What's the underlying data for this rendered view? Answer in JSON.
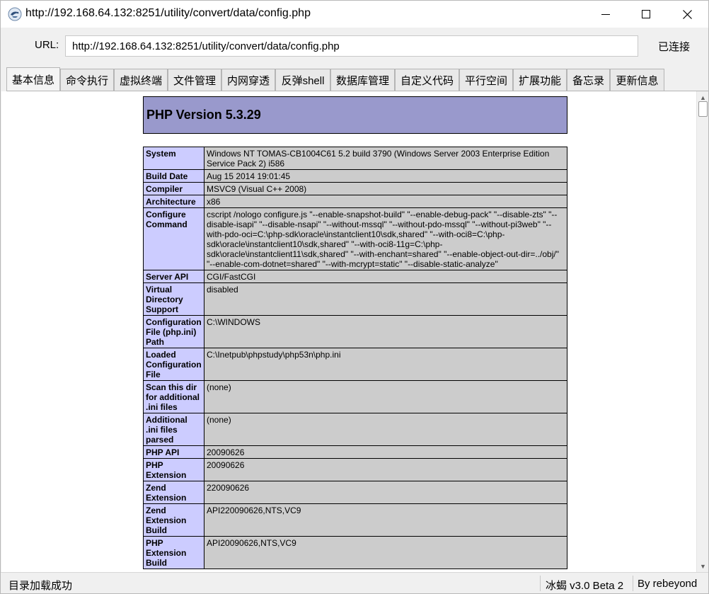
{
  "window": {
    "title": "http://192.168.64.132:8251/utility/convert/data/config.php",
    "icon": "scorpion-app-icon"
  },
  "urlbar": {
    "label": "URL:",
    "value": "http://192.168.64.132:8251/utility/convert/data/config.php",
    "status": "已连接"
  },
  "tabs": [
    {
      "label": "基本信息",
      "active": true
    },
    {
      "label": "命令执行"
    },
    {
      "label": "虚拟终端"
    },
    {
      "label": "文件管理"
    },
    {
      "label": "内网穿透"
    },
    {
      "label": "反弹shell"
    },
    {
      "label": "数据库管理"
    },
    {
      "label": "自定义代码"
    },
    {
      "label": "平行空间"
    },
    {
      "label": "扩展功能"
    },
    {
      "label": "备忘录"
    },
    {
      "label": "更新信息"
    }
  ],
  "phpinfo": {
    "heading": "PHP Version 5.3.29",
    "header_color": "#9999cc",
    "key_color": "#ccccff",
    "value_color": "#cccccc",
    "rows": [
      {
        "key": "System",
        "value": "Windows NT TOMAS-CB1004C61 5.2 build 3790 (Windows Server 2003 Enterprise Edition Service Pack 2) i586"
      },
      {
        "key": "Build Date",
        "value": "Aug 15 2014 19:01:45"
      },
      {
        "key": "Compiler",
        "value": "MSVC9 (Visual C++ 2008)"
      },
      {
        "key": "Architecture",
        "value": "x86"
      },
      {
        "key": "Configure Command",
        "value": "cscript /nologo configure.js \"--enable-snapshot-build\" \"--enable-debug-pack\" \"--disable-zts\" \"--disable-isapi\" \"--disable-nsapi\" \"--without-mssql\" \"--without-pdo-mssql\" \"--without-pi3web\" \"--with-pdo-oci=C:\\php-sdk\\oracle\\instantclient10\\sdk,shared\" \"--with-oci8=C:\\php-sdk\\oracle\\instantclient10\\sdk,shared\" \"--with-oci8-11g=C:\\php-sdk\\oracle\\instantclient11\\sdk,shared\" \"--with-enchant=shared\" \"--enable-object-out-dir=../obj/\" \"--enable-com-dotnet=shared\" \"--with-mcrypt=static\" \"--disable-static-analyze\""
      },
      {
        "key": "Server API",
        "value": "CGI/FastCGI"
      },
      {
        "key": "Virtual Directory Support",
        "value": "disabled"
      },
      {
        "key": "Configuration File (php.ini) Path",
        "value": "C:\\WINDOWS"
      },
      {
        "key": "Loaded Configuration File",
        "value": "C:\\Inetpub\\phpstudy\\php53n\\php.ini"
      },
      {
        "key": "Scan this dir for additional .ini files",
        "value": "(none)"
      },
      {
        "key": "Additional .ini files parsed",
        "value": "(none)"
      },
      {
        "key": "PHP API",
        "value": "20090626"
      },
      {
        "key": "PHP Extension",
        "value": "20090626"
      },
      {
        "key": "Zend Extension",
        "value": "220090626"
      },
      {
        "key": "Zend Extension Build",
        "value": "API220090626,NTS,VC9"
      },
      {
        "key": "PHP Extension Build",
        "value": "API20090626,NTS,VC9"
      }
    ]
  },
  "statusbar": {
    "message": "目录加载成功",
    "version": "冰蝎 v3.0 Beta 2",
    "author": "By rebeyond"
  }
}
